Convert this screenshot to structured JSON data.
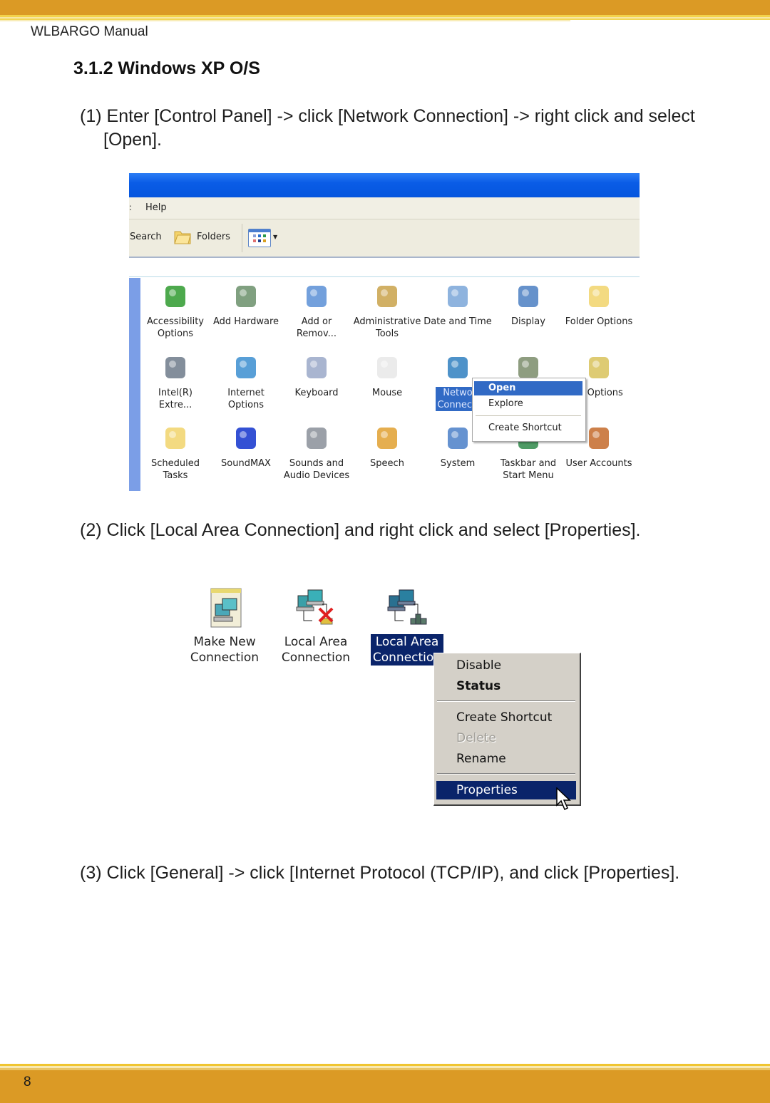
{
  "header": {
    "manual_title": "WLBARGO Manual"
  },
  "section": {
    "title": "3.1.2 Windows XP O/S"
  },
  "steps": [
    {
      "number": "(1)",
      "text_line1": "Enter [Control Panel] -> click [Network Connection] -> right click and select",
      "text_line2": "[Open]."
    },
    {
      "number": "(2)",
      "text": "Click [Local Area Connection] and right click and select [Properties]."
    },
    {
      "number": "(3)",
      "text": "Click [General] -> click [Internet Protocol (TCP/IP), and click [Properties]."
    }
  ],
  "control_panel": {
    "menu": {
      "truncated_prev": ":",
      "help": "Help"
    },
    "toolbar": {
      "search": "Search",
      "folders": "Folders",
      "views_icon": "views-icon"
    },
    "items": [
      {
        "label": "Accessibility\nOptions",
        "icon": "accessibility-icon",
        "color": "#2e9a2e"
      },
      {
        "label": "Add Hardware",
        "icon": "add-hardware-icon",
        "color": "#6a8f6a"
      },
      {
        "label": "Add or\nRemov...",
        "icon": "add-remove-programs-icon",
        "color": "#5b8fd6"
      },
      {
        "label": "Administrative\nTools",
        "icon": "administrative-tools-icon",
        "color": "#c9a24a"
      },
      {
        "label": "Date and Time",
        "icon": "date-time-icon",
        "color": "#7aa6d8"
      },
      {
        "label": "Display",
        "icon": "display-icon",
        "color": "#4b7fc2"
      },
      {
        "label": "Folder Options",
        "icon": "folder-options-icon",
        "color": "#f1d36b"
      },
      {
        "label": "Intel(R)\nExtre...",
        "icon": "intel-graphics-icon",
        "color": "#6d7a8a"
      },
      {
        "label": "Internet\nOptions",
        "icon": "internet-options-icon",
        "color": "#3b8ed0"
      },
      {
        "label": "Keyboard",
        "icon": "keyboard-icon",
        "color": "#9aa8c8"
      },
      {
        "label": "Mouse",
        "icon": "mouse-icon",
        "color": "#e8e8e8"
      },
      {
        "label": "Netwo\nConnecti",
        "icon": "network-connections-icon",
        "color": "#2f7fc0",
        "selected": true
      },
      {
        "label": "",
        "icon": "phone-modem-icon",
        "color": "#7a8c6a"
      },
      {
        "label": "er Options",
        "icon": "power-options-icon",
        "color": "#d8c25a"
      },
      {
        "label": "Scheduled\nTasks",
        "icon": "scheduled-tasks-icon",
        "color": "#f1d36b"
      },
      {
        "label": "SoundMAX",
        "icon": "soundmax-icon",
        "color": "#1133cc"
      },
      {
        "label": "Sounds and\nAudio Devices",
        "icon": "sounds-icon",
        "color": "#8a8f99"
      },
      {
        "label": "Speech",
        "icon": "speech-icon",
        "color": "#e0a030"
      },
      {
        "label": "System",
        "icon": "system-icon",
        "color": "#4a7fc8"
      },
      {
        "label": "Taskbar and\nStart Menu",
        "icon": "taskbar-icon",
        "color": "#2f8a4a"
      },
      {
        "label": "User Accounts",
        "icon": "user-accounts-icon",
        "color": "#c46a2a"
      }
    ],
    "context_menu": {
      "open": "Open",
      "explore": "Explore",
      "create_shortcut": "Create Shortcut"
    }
  },
  "network_connections": {
    "items": [
      {
        "label": "Make New\nConnection",
        "icon": "make-new-connection-icon"
      },
      {
        "label": "Local Area\nConnection",
        "icon": "local-area-connection-disconnected-icon"
      },
      {
        "label": "Local Area\nConnection",
        "icon": "local-area-connection-icon",
        "selected": true
      }
    ],
    "context_menu": {
      "disable": "Disable",
      "status": "Status",
      "create_shortcut": "Create Shortcut",
      "delete": "Delete",
      "rename": "Rename",
      "properties": "Properties"
    }
  },
  "footer": {
    "page_number": "8"
  },
  "colors": {
    "band": "#db9a25",
    "xp_blue": "#0a5ce6",
    "selection_xp": "#316ac5",
    "selection_classic": "#0a246a"
  }
}
